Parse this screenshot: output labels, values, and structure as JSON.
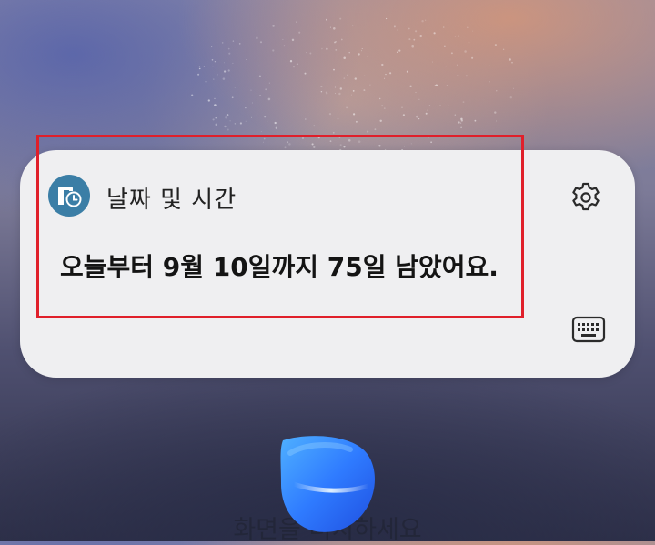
{
  "notification": {
    "app_icon": "calendar-clock-icon",
    "app_name": "날짜 및 시간",
    "message": "오늘부터 9월 10일까지 75일 남았어요.",
    "settings_icon": "gear-icon",
    "keyboard_icon": "keyboard-icon",
    "highlight_color": "#e01f2a"
  },
  "bottom": {
    "hint": "화면을 터치하세요",
    "assistant_icon": "assistant-orb-icon"
  },
  "colors": {
    "card_background": "#efeff1",
    "app_icon_background": "#3b7ea6",
    "orb_blue": "#2f7bff"
  }
}
